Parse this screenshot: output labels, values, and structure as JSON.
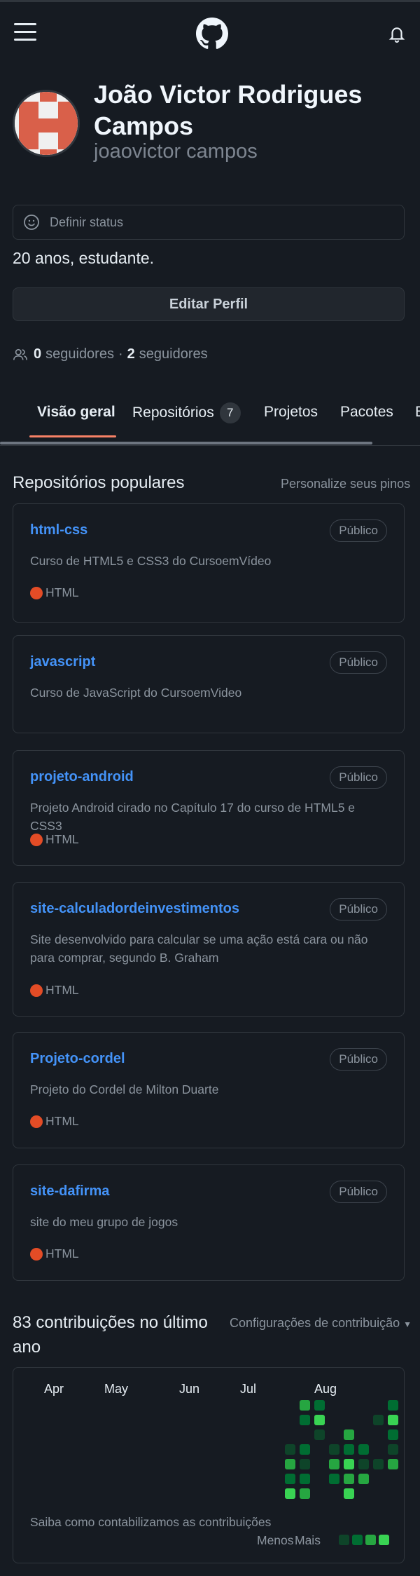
{
  "header": {
    "menu_icon": "hamburger-icon",
    "logo_icon": "github-logo-icon",
    "notifications_icon": "bell-icon"
  },
  "profile": {
    "name": "João Victor Rodrigues Campos",
    "username": "joaovictor campos",
    "status_placeholder": "Definir status",
    "bio": "20 anos, estudante.",
    "edit_button": "Editar Perfil",
    "followers_count": "0",
    "followers_label": "seguidores",
    "separator": "·",
    "following_count": "2",
    "following_label": "seguidores"
  },
  "tabs": [
    {
      "label": "Visão geral",
      "active": true
    },
    {
      "label": "Repositórios",
      "count": "7"
    },
    {
      "label": "Projetos"
    },
    {
      "label": "Pacotes"
    },
    {
      "label": "E"
    }
  ],
  "popular": {
    "title": "Repositórios populares",
    "customize_link": "Personalize seus pinos",
    "visibility_label": "Público",
    "repos": [
      {
        "name": "html-css",
        "description": "Curso de HTML5 e CSS3 do CursoemVídeo",
        "language": "HTML",
        "language_color": "#e34c26"
      },
      {
        "name": "javascript",
        "description": "Curso de JavaScript do CursoemVideo",
        "language": ""
      },
      {
        "name": "projeto-android",
        "description": "Projeto Android cirado no Capítulo 17 do curso de HTML5 e CSS3",
        "language": "HTML",
        "language_color": "#e34c26"
      },
      {
        "name": "site-calculadordeinvestimentos",
        "description": "Site desenvolvido para calcular se uma ação está cara ou não para comprar, segundo B. Graham",
        "language": "HTML",
        "language_color": "#e34c26"
      },
      {
        "name": "Projeto-cordel",
        "description": "Projeto do Cordel de Milton Duarte",
        "language": "HTML",
        "language_color": "#e34c26"
      },
      {
        "name": "site-dafirma",
        "description": "site do meu grupo de jogos",
        "language": "HTML",
        "language_color": "#e34c26"
      }
    ]
  },
  "contributions": {
    "title": "83 contribuições no último ano",
    "settings_link": "Configurações de contribuição",
    "months": [
      "Apr",
      "May",
      "Jun",
      "Jul",
      "Aug"
    ],
    "footer_link": "Saiba como contabilizamos as contribuições",
    "legend_less": "Menos",
    "legend_more": "Mais",
    "level_colors": [
      "#0e4429",
      "#006d32",
      "#26a641",
      "#39d353"
    ]
  }
}
